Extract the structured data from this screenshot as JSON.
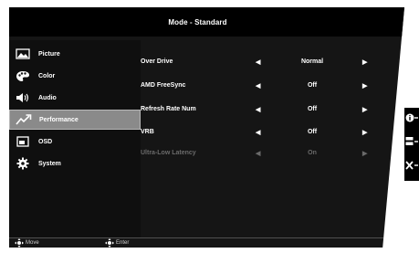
{
  "header": {
    "title": "Mode - Standard"
  },
  "sidebar": {
    "items": [
      {
        "label": "Picture",
        "icon": "picture-icon"
      },
      {
        "label": "Color",
        "icon": "palette-icon"
      },
      {
        "label": "Audio",
        "icon": "speaker-icon"
      },
      {
        "label": "Performance",
        "icon": "trend-icon",
        "active": true
      },
      {
        "label": "OSD",
        "icon": "osd-icon"
      },
      {
        "label": "System",
        "icon": "gear-icon"
      }
    ]
  },
  "settings": [
    {
      "label": "Over Drive",
      "value": "Normal",
      "enabled": true
    },
    {
      "label": "AMD FreeSync",
      "value": "Off",
      "enabled": true
    },
    {
      "label": "Refresh Rate Num",
      "value": "Off",
      "enabled": true
    },
    {
      "label": "VRB",
      "value": "Off",
      "enabled": true
    },
    {
      "label": "Ultra-Low Latency",
      "value": "On",
      "enabled": false
    }
  ],
  "footer": {
    "move_label": "Move",
    "enter_label": "Enter"
  },
  "colors": {
    "active_bg": "#8a8a8a",
    "panel_bg": "#151515",
    "disabled_text": "#6a6a6a"
  }
}
